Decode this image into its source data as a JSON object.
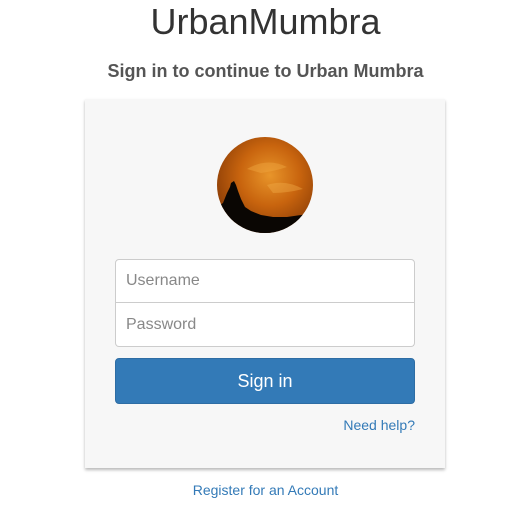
{
  "header": {
    "app_title": "UrbanMumbra",
    "subtitle": "Sign in to continue to Urban Mumbra"
  },
  "login_card": {
    "avatar_icon": "profile-photo-sunset-silhouette",
    "username_placeholder": "Username",
    "username_value": "",
    "password_placeholder": "Password",
    "password_value": "",
    "signin_label": "Sign in",
    "help_label": "Need help?"
  },
  "footer": {
    "register_label": "Register for an Account"
  },
  "colors": {
    "accent": "#337ab7",
    "card_background": "#f7f7f7"
  }
}
